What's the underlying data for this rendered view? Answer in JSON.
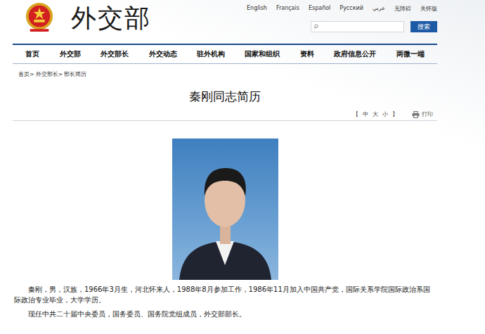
{
  "header": {
    "logo_text": "外交部",
    "languages": [
      "English",
      "Français",
      "Español",
      "Русский",
      "عربي",
      "无障碍",
      "关怀版"
    ],
    "search": {
      "placeholder": "",
      "button": "搜索"
    }
  },
  "nav": [
    {
      "label": "首页",
      "selected": false
    },
    {
      "label": "外交部",
      "selected": false
    },
    {
      "label": "外交部长",
      "selected": false
    },
    {
      "label": "外交动态",
      "selected": false
    },
    {
      "label": "驻外机构",
      "selected": false
    },
    {
      "label": "国家和组织",
      "selected": false
    },
    {
      "label": "资料",
      "selected": false
    },
    {
      "label": "政府信息公开",
      "selected": false
    },
    {
      "label": "两微一端",
      "selected": false
    }
  ],
  "breadcrumb": {
    "items": [
      "首页",
      "外交部长",
      "部长简历"
    ],
    "separator": ">"
  },
  "article": {
    "title": "秦刚同志简历",
    "font_size": {
      "open": "【",
      "sizes": [
        "中",
        "大",
        "小"
      ],
      "close": "】"
    },
    "print": "打印",
    "paragraphs": [
      "秦刚，男，汉族，1966年3月生，河北怀来人，1988年8月参加工作，1986年11月加入中国共产党，国际关系学院国际政治系国际政治专业毕业，大学学历。",
      "现任中共二十届中央委员，国务委员、国务院党组成员，外交部部长。"
    ]
  }
}
